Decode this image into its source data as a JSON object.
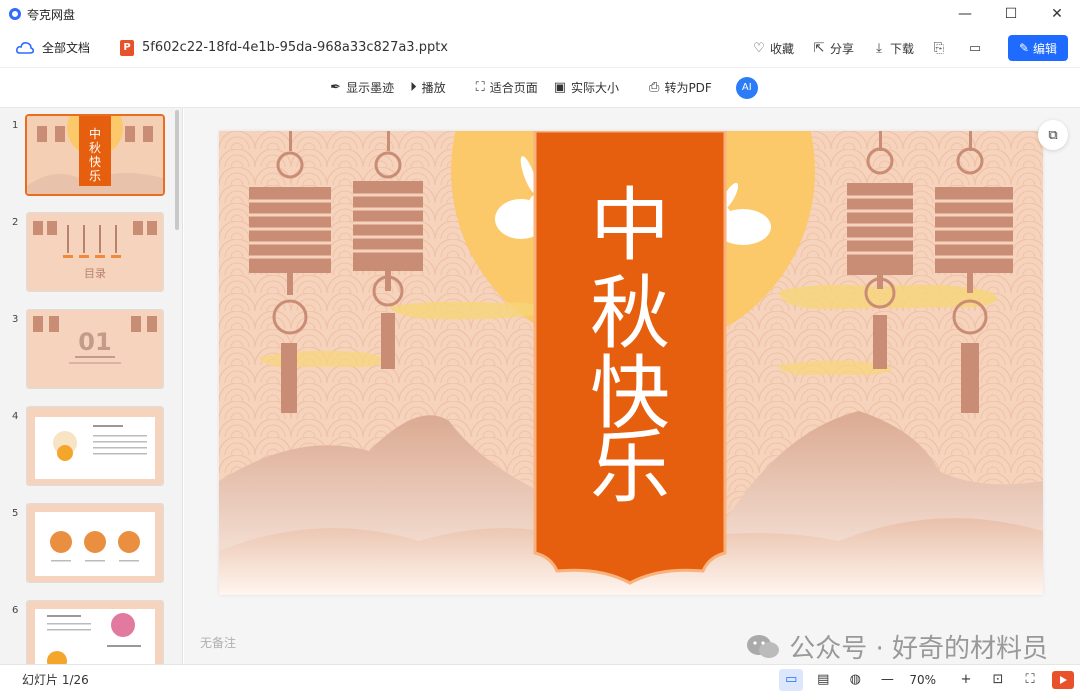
{
  "app": {
    "title": "夸克网盘"
  },
  "window": {
    "minimize": "—",
    "maximize": "☐",
    "close": "✕"
  },
  "docbar": {
    "all_docs": "全部文档",
    "filename": "5f602c22-18fd-4e1b-95da-968a33c827a3.pptx",
    "ppt_badge": "P",
    "actions": {
      "favorite": "收藏",
      "share": "分享",
      "download": "下载"
    },
    "edit": "编辑"
  },
  "toolbar": {
    "ink": "显示墨迹",
    "play": "播放",
    "fit_page": "适合页面",
    "actual_size": "实际大小",
    "to_pdf": "转为PDF",
    "ai": "AI"
  },
  "slides": [
    {
      "num": "1",
      "title": "中秋快乐"
    },
    {
      "num": "2",
      "title": "目录"
    },
    {
      "num": "3",
      "title": "01"
    },
    {
      "num": "4"
    },
    {
      "num": "5"
    },
    {
      "num": "6"
    }
  ],
  "current_slide": {
    "title_chars": [
      "中",
      "秋",
      "快",
      "乐"
    ]
  },
  "notes": {
    "placeholder": "无备注"
  },
  "watermark": {
    "text": "公众号 · 好奇的材料员"
  },
  "status": {
    "slide_count": "幻灯片 1/26",
    "zoom": "70%"
  },
  "colors": {
    "accent": "#1f6bff",
    "slide_bg": "#f5cfb3",
    "banner": "#e65f0e",
    "sun": "#fbc96a",
    "lantern": "#c98c74"
  }
}
